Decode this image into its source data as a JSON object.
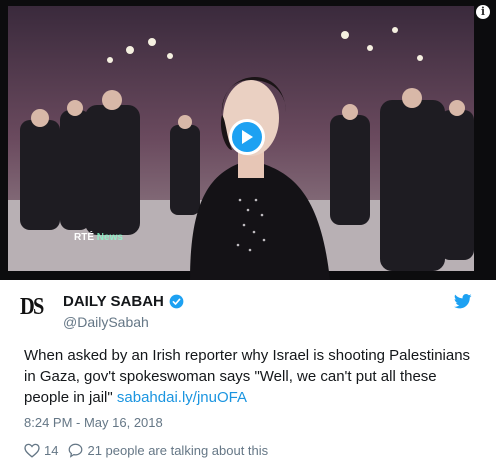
{
  "video": {
    "rte_brand": "RTÉ",
    "rte_suffix": "News",
    "info_label": "i"
  },
  "account": {
    "logo": "DS",
    "name": "DAILY SABAH",
    "handle": "@DailySabah"
  },
  "tweet": {
    "text": "When asked by an Irish reporter why Israel is shooting Palestinians in Gaza, gov't spokeswoman says \"Well, we can't put all these people in jail\" ",
    "link": "sabahdai.ly/jnuOFA",
    "timestamp": "8:24 PM - May 16, 2018"
  },
  "actions": {
    "likes": "14",
    "replies_text": "21 people are talking about this"
  },
  "colors": {
    "accent": "#1da1f2",
    "link": "#1b95e0",
    "secondary": "#657786"
  }
}
